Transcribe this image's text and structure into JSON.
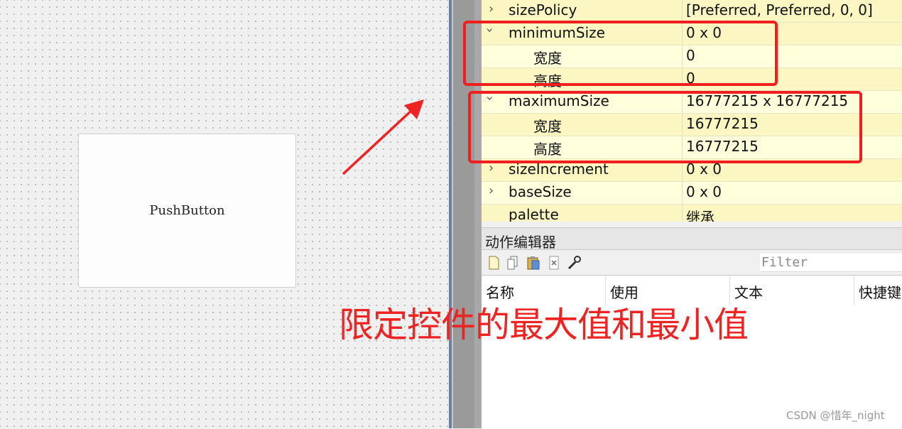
{
  "designer": {
    "push_button_label": "PushButton"
  },
  "property_editor": {
    "rows": [
      {
        "name": "sizePolicy",
        "value": "[Preferred, Preferred, 0, 0]",
        "expand": "collapsed"
      },
      {
        "name": "minimumSize",
        "value": "0 x 0",
        "expand": "expanded"
      },
      {
        "name": "宽度",
        "value": "0",
        "expand": "child"
      },
      {
        "name": "高度",
        "value": "0",
        "expand": "child"
      },
      {
        "name": "maximumSize",
        "value": "16777215 x 16777215",
        "expand": "expanded"
      },
      {
        "name": "宽度",
        "value": "16777215",
        "expand": "child"
      },
      {
        "name": "高度",
        "value": "16777215",
        "expand": "child"
      },
      {
        "name": "sizeIncrement",
        "value": "0 x 0",
        "expand": "collapsed"
      },
      {
        "name": "baseSize",
        "value": "0 x 0",
        "expand": "collapsed"
      },
      {
        "name": "palette",
        "value": "继承",
        "expand": "none"
      }
    ],
    "collapsed_glyph": "›",
    "expanded_glyph": "⌄"
  },
  "action_editor": {
    "title": "动作编辑器",
    "filter_placeholder": "Filter",
    "toolbar_icons": [
      "new-action-icon",
      "copy-action-icon",
      "paste-action-icon",
      "delete-action-icon",
      "configure-icon"
    ],
    "columns": [
      "名称",
      "使用",
      "文本",
      "快捷键"
    ]
  },
  "annotation": {
    "caption": "限定控件的最大值和最小值",
    "color": "#f02323"
  },
  "watermark": "CSDN @惜年_night"
}
